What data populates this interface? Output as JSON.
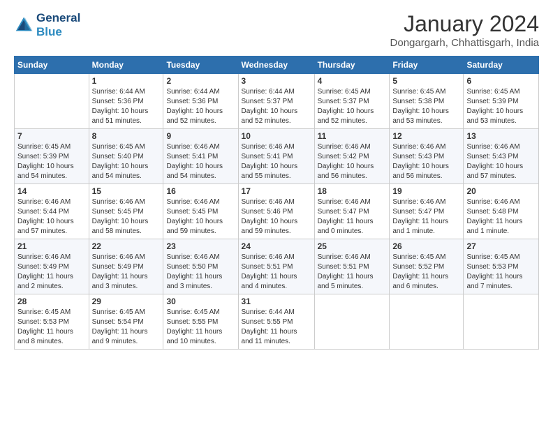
{
  "header": {
    "logo_line1": "General",
    "logo_line2": "Blue",
    "month_title": "January 2024",
    "location": "Dongargarh, Chhattisgarh, India"
  },
  "days_of_week": [
    "Sunday",
    "Monday",
    "Tuesday",
    "Wednesday",
    "Thursday",
    "Friday",
    "Saturday"
  ],
  "weeks": [
    [
      {
        "day": "",
        "info": ""
      },
      {
        "day": "1",
        "info": "Sunrise: 6:44 AM\nSunset: 5:36 PM\nDaylight: 10 hours\nand 51 minutes."
      },
      {
        "day": "2",
        "info": "Sunrise: 6:44 AM\nSunset: 5:36 PM\nDaylight: 10 hours\nand 52 minutes."
      },
      {
        "day": "3",
        "info": "Sunrise: 6:44 AM\nSunset: 5:37 PM\nDaylight: 10 hours\nand 52 minutes."
      },
      {
        "day": "4",
        "info": "Sunrise: 6:45 AM\nSunset: 5:37 PM\nDaylight: 10 hours\nand 52 minutes."
      },
      {
        "day": "5",
        "info": "Sunrise: 6:45 AM\nSunset: 5:38 PM\nDaylight: 10 hours\nand 53 minutes."
      },
      {
        "day": "6",
        "info": "Sunrise: 6:45 AM\nSunset: 5:39 PM\nDaylight: 10 hours\nand 53 minutes."
      }
    ],
    [
      {
        "day": "7",
        "info": "Sunrise: 6:45 AM\nSunset: 5:39 PM\nDaylight: 10 hours\nand 54 minutes."
      },
      {
        "day": "8",
        "info": "Sunrise: 6:45 AM\nSunset: 5:40 PM\nDaylight: 10 hours\nand 54 minutes."
      },
      {
        "day": "9",
        "info": "Sunrise: 6:46 AM\nSunset: 5:41 PM\nDaylight: 10 hours\nand 54 minutes."
      },
      {
        "day": "10",
        "info": "Sunrise: 6:46 AM\nSunset: 5:41 PM\nDaylight: 10 hours\nand 55 minutes."
      },
      {
        "day": "11",
        "info": "Sunrise: 6:46 AM\nSunset: 5:42 PM\nDaylight: 10 hours\nand 56 minutes."
      },
      {
        "day": "12",
        "info": "Sunrise: 6:46 AM\nSunset: 5:43 PM\nDaylight: 10 hours\nand 56 minutes."
      },
      {
        "day": "13",
        "info": "Sunrise: 6:46 AM\nSunset: 5:43 PM\nDaylight: 10 hours\nand 57 minutes."
      }
    ],
    [
      {
        "day": "14",
        "info": "Sunrise: 6:46 AM\nSunset: 5:44 PM\nDaylight: 10 hours\nand 57 minutes."
      },
      {
        "day": "15",
        "info": "Sunrise: 6:46 AM\nSunset: 5:45 PM\nDaylight: 10 hours\nand 58 minutes."
      },
      {
        "day": "16",
        "info": "Sunrise: 6:46 AM\nSunset: 5:45 PM\nDaylight: 10 hours\nand 59 minutes."
      },
      {
        "day": "17",
        "info": "Sunrise: 6:46 AM\nSunset: 5:46 PM\nDaylight: 10 hours\nand 59 minutes."
      },
      {
        "day": "18",
        "info": "Sunrise: 6:46 AM\nSunset: 5:47 PM\nDaylight: 11 hours\nand 0 minutes."
      },
      {
        "day": "19",
        "info": "Sunrise: 6:46 AM\nSunset: 5:47 PM\nDaylight: 11 hours\nand 1 minute."
      },
      {
        "day": "20",
        "info": "Sunrise: 6:46 AM\nSunset: 5:48 PM\nDaylight: 11 hours\nand 1 minute."
      }
    ],
    [
      {
        "day": "21",
        "info": "Sunrise: 6:46 AM\nSunset: 5:49 PM\nDaylight: 11 hours\nand 2 minutes."
      },
      {
        "day": "22",
        "info": "Sunrise: 6:46 AM\nSunset: 5:49 PM\nDaylight: 11 hours\nand 3 minutes."
      },
      {
        "day": "23",
        "info": "Sunrise: 6:46 AM\nSunset: 5:50 PM\nDaylight: 11 hours\nand 3 minutes."
      },
      {
        "day": "24",
        "info": "Sunrise: 6:46 AM\nSunset: 5:51 PM\nDaylight: 11 hours\nand 4 minutes."
      },
      {
        "day": "25",
        "info": "Sunrise: 6:46 AM\nSunset: 5:51 PM\nDaylight: 11 hours\nand 5 minutes."
      },
      {
        "day": "26",
        "info": "Sunrise: 6:45 AM\nSunset: 5:52 PM\nDaylight: 11 hours\nand 6 minutes."
      },
      {
        "day": "27",
        "info": "Sunrise: 6:45 AM\nSunset: 5:53 PM\nDaylight: 11 hours\nand 7 minutes."
      }
    ],
    [
      {
        "day": "28",
        "info": "Sunrise: 6:45 AM\nSunset: 5:53 PM\nDaylight: 11 hours\nand 8 minutes."
      },
      {
        "day": "29",
        "info": "Sunrise: 6:45 AM\nSunset: 5:54 PM\nDaylight: 11 hours\nand 9 minutes."
      },
      {
        "day": "30",
        "info": "Sunrise: 6:45 AM\nSunset: 5:55 PM\nDaylight: 11 hours\nand 10 minutes."
      },
      {
        "day": "31",
        "info": "Sunrise: 6:44 AM\nSunset: 5:55 PM\nDaylight: 11 hours\nand 11 minutes."
      },
      {
        "day": "",
        "info": ""
      },
      {
        "day": "",
        "info": ""
      },
      {
        "day": "",
        "info": ""
      }
    ]
  ]
}
